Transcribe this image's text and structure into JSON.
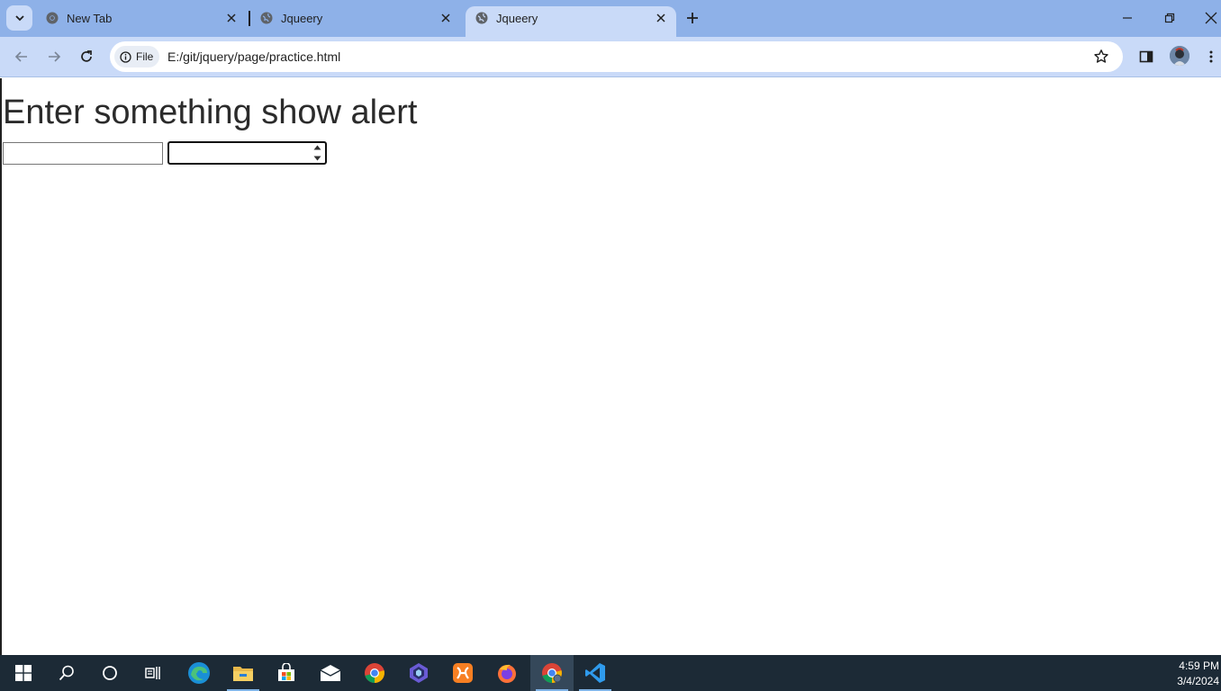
{
  "browser": {
    "tabs": [
      {
        "title": "New Tab",
        "active": false
      },
      {
        "title": "Jqueery",
        "active": false
      },
      {
        "title": "Jqueery",
        "active": true
      }
    ],
    "omnibox": {
      "chip_label": "File",
      "url": "E:/git/jquery/page/practice.html"
    },
    "colors": {
      "tabstrip": "#8eb1e8",
      "toolbar": "#c9daf8",
      "active_tab": "#c9daf8"
    }
  },
  "page": {
    "heading": "Enter something show alert",
    "text_input": {
      "value": "",
      "placeholder": ""
    },
    "number_input": {
      "value": "",
      "placeholder": ""
    }
  },
  "taskbar": {
    "apps": [
      "start-icon",
      "search-icon",
      "cortana-icon",
      "task-view-icon",
      "edge-icon",
      "file-explorer-icon",
      "store-icon",
      "mail-icon",
      "chrome-icon",
      "copilot-icon",
      "xampp-icon",
      "firefox-icon",
      "chrome-active-icon",
      "vscode-icon"
    ],
    "clock": {
      "time": "4:59 PM",
      "date": "3/4/2024"
    },
    "color": "#1c2a36"
  }
}
